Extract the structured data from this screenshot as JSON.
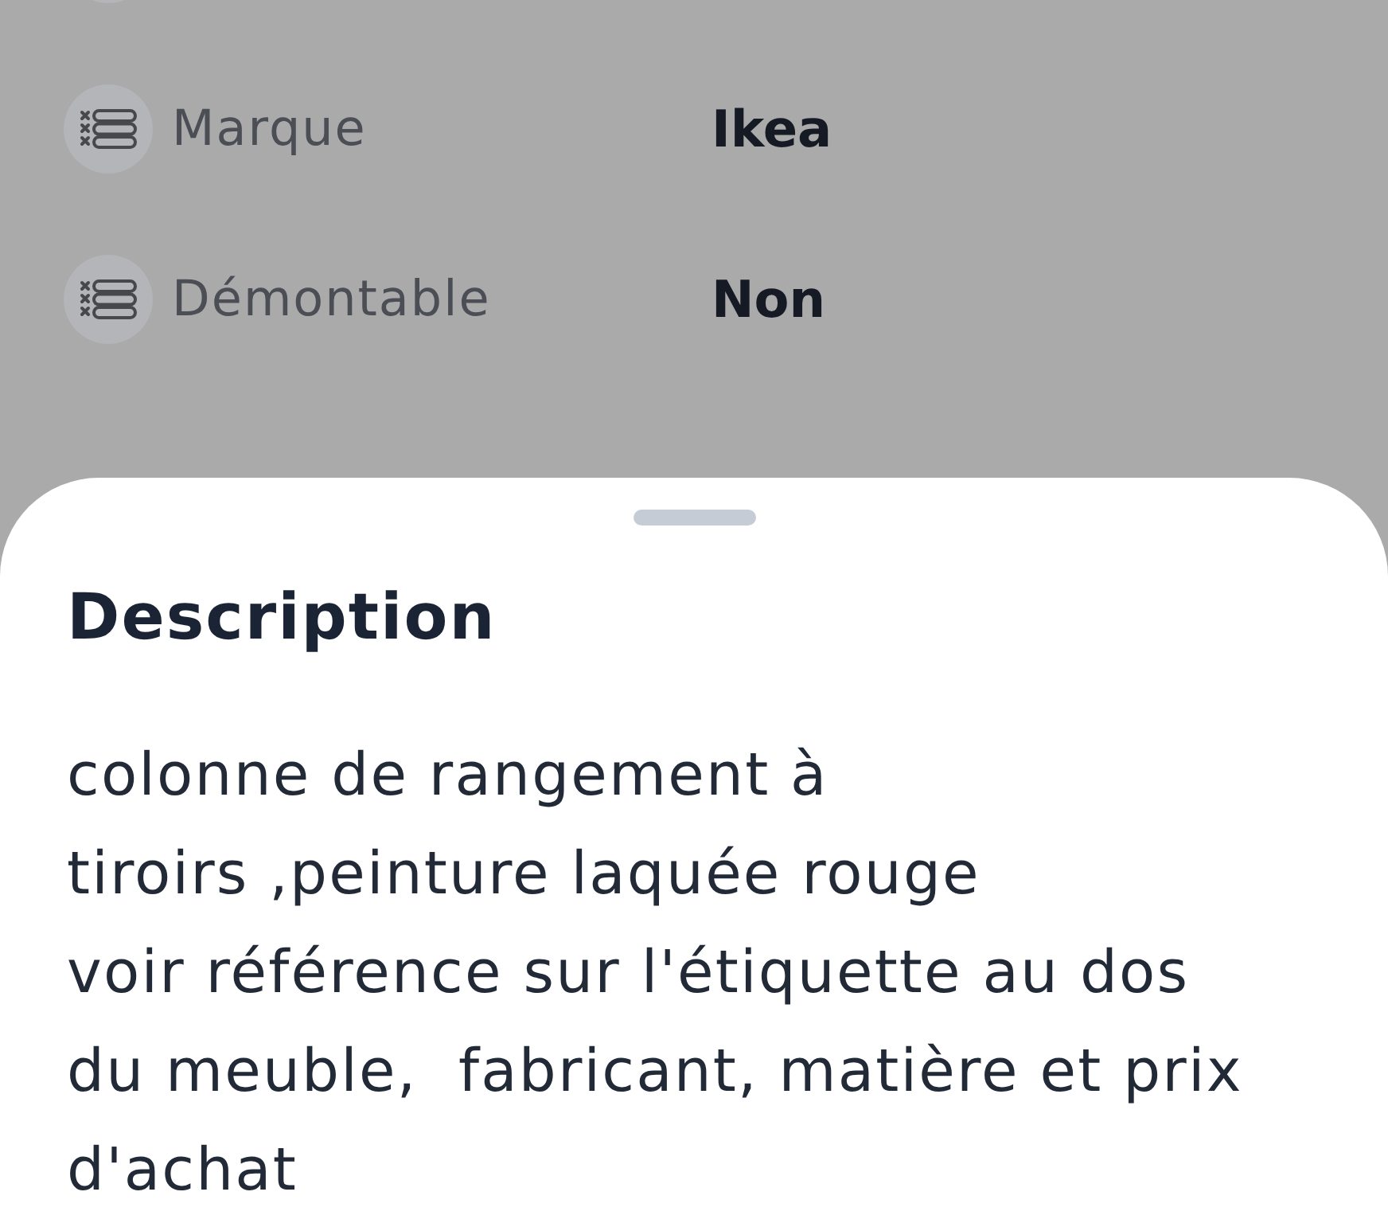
{
  "details": [
    {
      "label": "Marque",
      "value": "Ikea"
    },
    {
      "label": "Démontable",
      "value": "Non"
    }
  ],
  "sheet": {
    "title": "Description",
    "text": "colonne de rangement à\ntiroirs ,peinture laquée rouge\nvoir référence sur l'étiquette au dos\ndu meuble,  fabricant, matière et prix\nd'achat"
  }
}
